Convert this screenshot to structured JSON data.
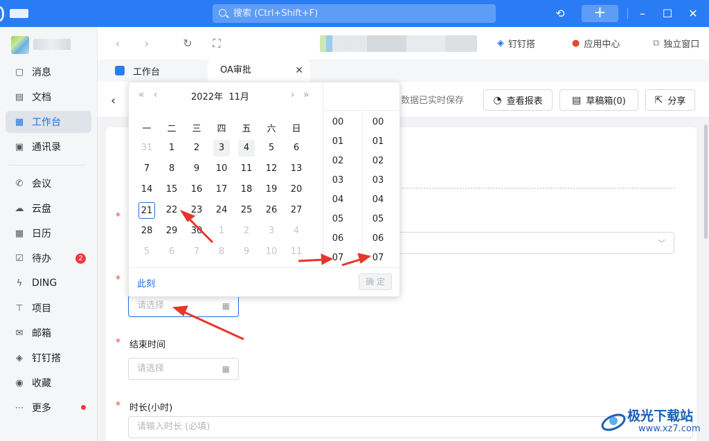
{
  "titlebar": {
    "search_placeholder": "搜索 (Ctrl+Shift+F)",
    "plus": "+"
  },
  "sidebar": {
    "items": [
      {
        "icon": "message-icon",
        "label": "消息"
      },
      {
        "icon": "document-icon",
        "label": "文档"
      },
      {
        "icon": "workbench-icon",
        "label": "工作台",
        "active": true
      },
      {
        "icon": "contacts-icon",
        "label": "通讯录"
      },
      {
        "icon": "phone-icon",
        "label": "会议"
      },
      {
        "icon": "cloud-icon",
        "label": "云盘"
      },
      {
        "icon": "calendar-icon",
        "label": "日历"
      },
      {
        "icon": "todo-icon",
        "label": "待办",
        "badge": "2"
      },
      {
        "icon": "lightning-icon",
        "label": "DING"
      },
      {
        "icon": "project-icon",
        "label": "项目"
      },
      {
        "icon": "mail-icon",
        "label": "邮箱"
      },
      {
        "icon": "dingdingda-icon",
        "label": "钉钉搭"
      },
      {
        "icon": "favorites-icon",
        "label": "收藏"
      },
      {
        "icon": "more-icon",
        "label": "更多"
      }
    ]
  },
  "toolbar": {
    "dingda": "钉钉搭",
    "appcenter": "应用中心",
    "standalone": "独立窗口"
  },
  "tabs": [
    {
      "label": "工作台"
    },
    {
      "label": "OA审批"
    }
  ],
  "header": {
    "saved": "数据已实时保存",
    "report": "查看报表",
    "drafts": "草稿箱(0)",
    "share": "分享"
  },
  "form": {
    "start_placeholder": "请选择",
    "end_label": "结束时间",
    "end_placeholder": "请选择",
    "duration_label": "时长(小时)",
    "duration_placeholder": "请输入时长 (必填)",
    "required_mark": "*"
  },
  "datepicker": {
    "year": "2022年",
    "month": "11月",
    "weekdays": [
      "一",
      "二",
      "三",
      "四",
      "五",
      "六",
      "日"
    ],
    "weeks": [
      [
        "31",
        "1",
        "2",
        "3",
        "4",
        "5",
        "6"
      ],
      [
        "7",
        "8",
        "9",
        "10",
        "11",
        "12",
        "13"
      ],
      [
        "14",
        "15",
        "16",
        "17",
        "18",
        "19",
        "20"
      ],
      [
        "21",
        "22",
        "23",
        "24",
        "25",
        "26",
        "27"
      ],
      [
        "28",
        "29",
        "30",
        "1",
        "2",
        "3",
        "4"
      ],
      [
        "5",
        "6",
        "7",
        "8",
        "9",
        "10",
        "11"
      ]
    ],
    "hours": [
      "00",
      "01",
      "02",
      "03",
      "04",
      "05",
      "06",
      "07"
    ],
    "minutes": [
      "00",
      "01",
      "02",
      "03",
      "04",
      "05",
      "06",
      "07"
    ],
    "now": "此刻",
    "ok": "确 定"
  },
  "watermark": {
    "name": "极光下载站",
    "url": "www.xz7.com"
  },
  "colors": {
    "accent": "#2a7cf4",
    "active_text": "#1d6fe6",
    "danger": "#f03a3a",
    "arrow": "#e8342a"
  }
}
